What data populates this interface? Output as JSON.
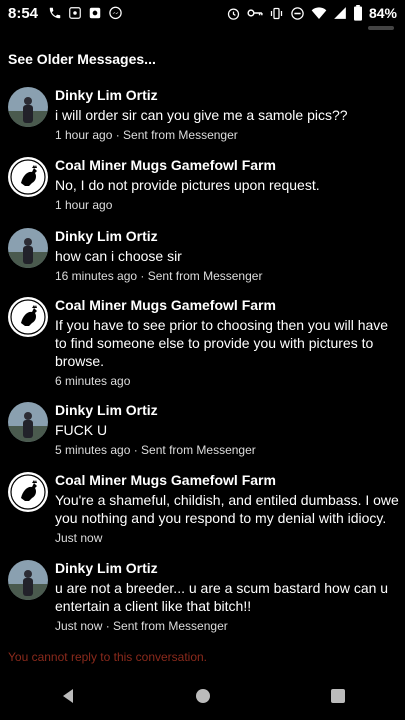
{
  "status_bar": {
    "time": "8:54",
    "battery": "84%",
    "left_icons": [
      "phone-icon",
      "voicemail-icon",
      "camera-icon",
      "messenger-icon"
    ],
    "right_icons": [
      "alarm-icon",
      "key-icon",
      "vibrate-icon",
      "dnd-icon",
      "wifi-icon",
      "signal-icon",
      "battery-icon"
    ]
  },
  "see_older": "See Older Messages...",
  "messages": [
    {
      "sender": "Dinky Lim Ortiz",
      "avatar": "person",
      "text": "i will order sir can you give me a samole pics??",
      "meta": "1 hour ago · Sent from Messenger"
    },
    {
      "sender": "Coal Miner Mugs Gamefowl Farm",
      "avatar": "rooster",
      "text": "No, I do not provide pictures upon request.",
      "meta": "1 hour ago"
    },
    {
      "sender": "Dinky Lim Ortiz",
      "avatar": "person",
      "text": "how can i choose sir",
      "meta": "16 minutes ago · Sent from Messenger"
    },
    {
      "sender": "Coal Miner Mugs Gamefowl Farm",
      "avatar": "rooster",
      "text": "If you have to see prior to choosing then you will have to find someone else to provide you with pictures to browse.",
      "meta": "6 minutes ago"
    },
    {
      "sender": "Dinky Lim Ortiz",
      "avatar": "person",
      "text": "FUCK U",
      "meta": "5 minutes ago · Sent from Messenger"
    },
    {
      "sender": "Coal Miner Mugs Gamefowl Farm",
      "avatar": "rooster",
      "text": "You're a shameful, childish, and entiled dumbass. I owe you nothing and you respond to my denial with idiocy.",
      "meta": "Just now"
    },
    {
      "sender": "Dinky Lim Ortiz",
      "avatar": "person",
      "text": "u are not a breeder... u are a scum bastard how can u entertain a client like that bitch!!",
      "meta": "Just now · Sent from Messenger"
    }
  ],
  "cannot_reply": "You cannot reply to this conversation.",
  "colors": {
    "background": "#000000",
    "cannot_reply": "#8b2a1c",
    "meta_text": "#dddddd"
  }
}
